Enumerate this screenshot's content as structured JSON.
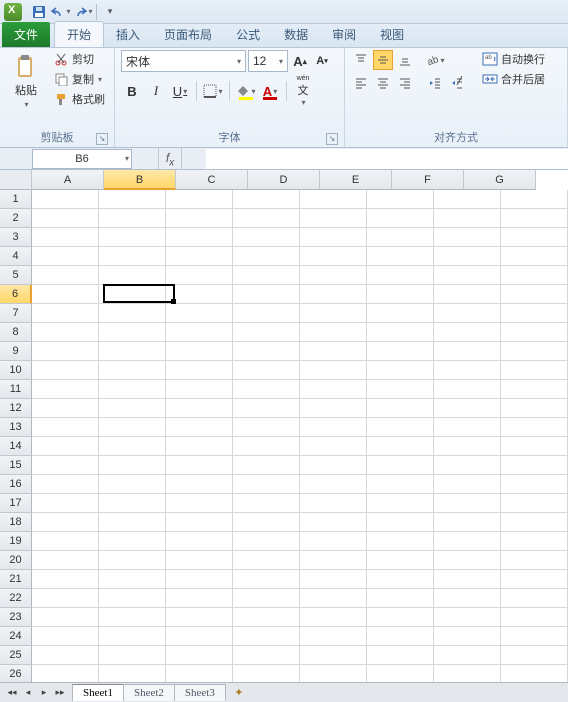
{
  "tabs": {
    "file": "文件",
    "home": "开始",
    "insert": "插入",
    "layout": "页面布局",
    "formulas": "公式",
    "data": "数据",
    "review": "审阅",
    "view": "视图"
  },
  "clipboard": {
    "paste": "粘贴",
    "cut": "剪切",
    "copy": "复制",
    "format_painter": "格式刷",
    "group": "剪贴板"
  },
  "font": {
    "name": "宋体",
    "size": "12",
    "group": "字体",
    "bold": "B",
    "italic": "I",
    "underline": "U",
    "wen": "wén"
  },
  "alignment": {
    "group": "对齐方式",
    "wrap": "自动换行",
    "merge": "合并后居"
  },
  "namebox": "B6",
  "columns": [
    "A",
    "B",
    "C",
    "D",
    "E",
    "F",
    "G"
  ],
  "rows": [
    "1",
    "2",
    "3",
    "4",
    "5",
    "6",
    "7",
    "8",
    "9",
    "10",
    "11",
    "12",
    "13",
    "14",
    "15",
    "16",
    "17",
    "18",
    "19",
    "20",
    "21",
    "22",
    "23",
    "24",
    "25",
    "26"
  ],
  "selected": {
    "col": 1,
    "row": 5
  },
  "sheets": {
    "s1": "Sheet1",
    "s2": "Sheet2",
    "s3": "Sheet3"
  }
}
